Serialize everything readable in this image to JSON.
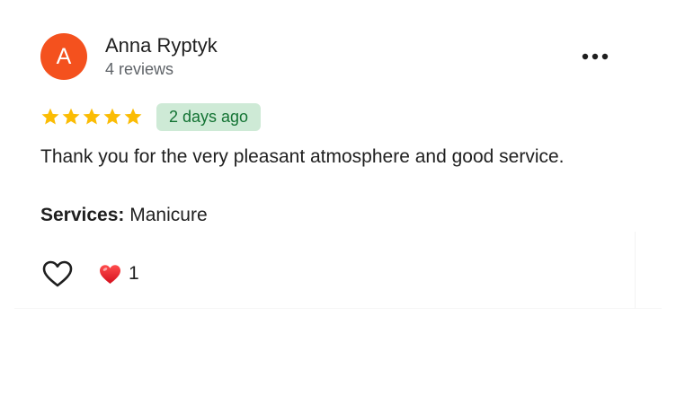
{
  "review": {
    "author": {
      "initial": "A",
      "name": "Anna Ryptyk",
      "review_count": "4 reviews",
      "avatar_color": "#f4511e"
    },
    "rating": 5,
    "rating_max": 5,
    "star_color": "#fbbc04",
    "date": "2 days ago",
    "date_badge_bg": "#ceead6",
    "text": "Thank you for the very pleasant atmosphere and good service.",
    "services_label": "Services:",
    "services_value": "Manicure",
    "reaction": {
      "icon": "red-heart-icon",
      "count": "1"
    },
    "actions": {
      "more_icon": "more-horizontal-icon",
      "like_icon": "heart-outline-icon"
    }
  }
}
